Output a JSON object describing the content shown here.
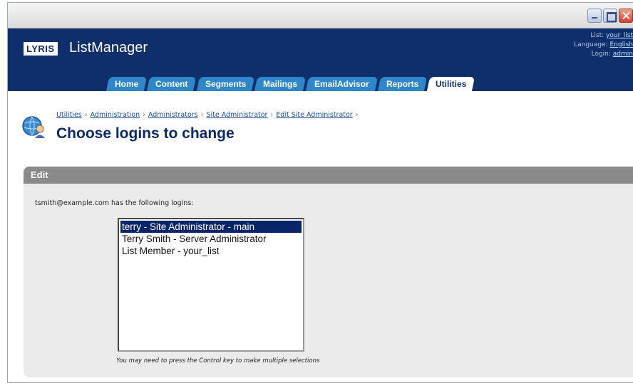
{
  "header": {
    "logo": "LYRIS",
    "app_name": "ListManager",
    "list_label": "List:",
    "list_value": "your_list",
    "language_label": "Language:",
    "language_value": "English",
    "login_label": "Login:",
    "login_value": "admin"
  },
  "tabs": [
    {
      "label": "Home"
    },
    {
      "label": "Content"
    },
    {
      "label": "Segments"
    },
    {
      "label": "Mailings"
    },
    {
      "label": "EmailAdvisor"
    },
    {
      "label": "Reports"
    },
    {
      "label": "Utilities",
      "active": true
    }
  ],
  "breadcrumb": [
    "Utilities",
    "Administration",
    "Administrators",
    "Site Administrator",
    "Edit Site Administrator"
  ],
  "page_title": "Choose logins to change",
  "panel": {
    "heading": "Edit",
    "intro": "tsmith@example.com has the following logins:",
    "options": [
      {
        "label": "terry - Site Administrator - main",
        "selected": true
      },
      {
        "label": "Terry Smith - Server Administrator",
        "selected": false
      },
      {
        "label": "List Member - your_list",
        "selected": false
      }
    ],
    "hint": "You may need to press the Control key to make multiple selections"
  },
  "colors": {
    "header_bg": "#0e2e6c",
    "tab_bg": "#2e87c8",
    "selection": "#0a246a",
    "panel_head": "#8a8a8a"
  },
  "icons": [
    "minimize-icon",
    "maximize-icon",
    "close-icon",
    "globe-person-icon"
  ]
}
